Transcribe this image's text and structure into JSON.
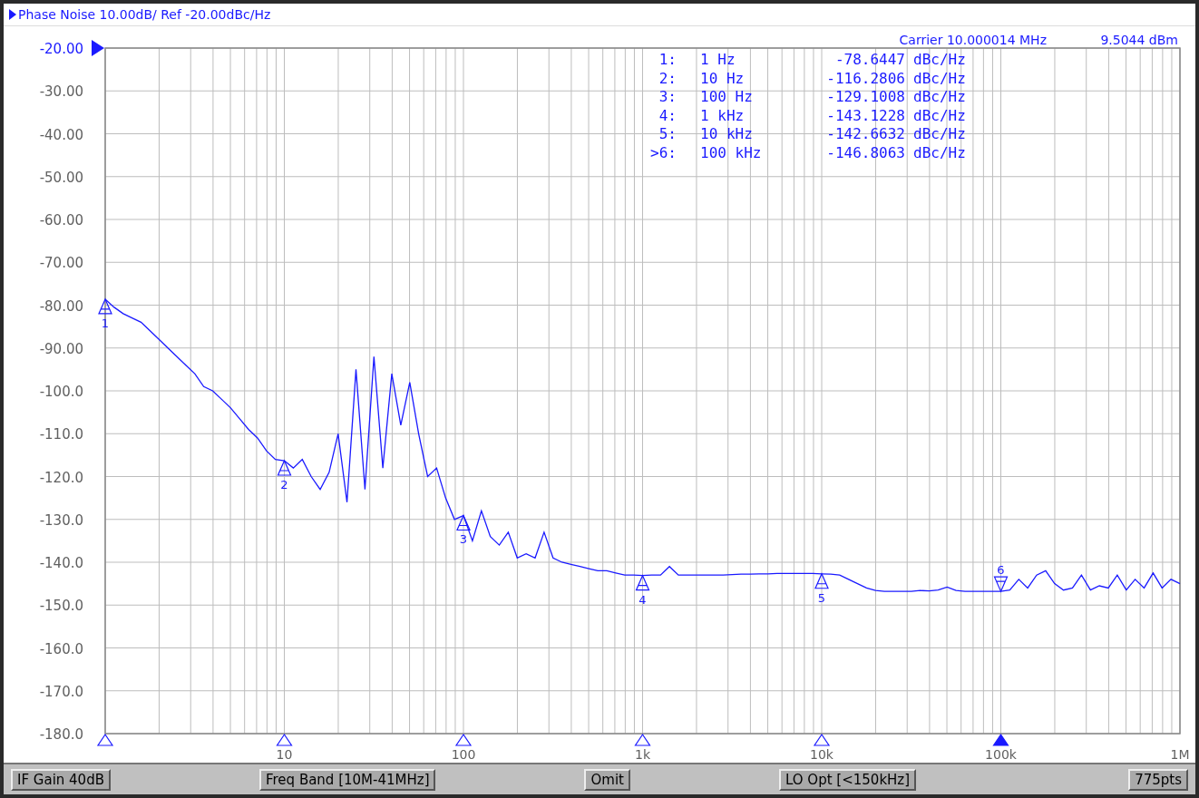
{
  "header": {
    "title": "Phase Noise 10.00dB/ Ref -20.00dBc/Hz"
  },
  "carrier": {
    "frequency": "Carrier 10.000014 MHz",
    "power": "9.5044 dBm"
  },
  "marker_table": [
    {
      "label": "1:",
      "frequency": "1 Hz",
      "value": "-78.6447",
      "unit": "dBc/Hz"
    },
    {
      "label": "2:",
      "frequency": "10 Hz",
      "value": "-116.2806",
      "unit": "dBc/Hz"
    },
    {
      "label": "3:",
      "frequency": "100 Hz",
      "value": "-129.1008",
      "unit": "dBc/Hz"
    },
    {
      "label": "4:",
      "frequency": "1 kHz",
      "value": "-143.1228",
      "unit": "dBc/Hz"
    },
    {
      "label": "5:",
      "frequency": "10 kHz",
      "value": "-142.6632",
      "unit": "dBc/Hz"
    },
    {
      "label": ">6:",
      "frequency": "100 kHz",
      "value": "-146.8063",
      "unit": "dBc/Hz"
    }
  ],
  "trace_markers": [
    {
      "number": "1",
      "selected": false
    },
    {
      "number": "2",
      "selected": false
    },
    {
      "number": "3",
      "selected": false
    },
    {
      "number": "4",
      "selected": false
    },
    {
      "number": "5",
      "selected": false
    },
    {
      "number": "6",
      "selected": true
    }
  ],
  "reference": {
    "label": "-20.00"
  },
  "chart_data": {
    "type": "line",
    "grid": true,
    "categories": [
      null,
      null,
      null,
      null,
      null,
      null,
      null,
      null,
      null,
      null,
      null,
      null,
      null,
      null,
      null,
      null,
      null,
      null,
      null,
      null,
      "10",
      null,
      null,
      null,
      null,
      null,
      null,
      null,
      null,
      null,
      null,
      null,
      null,
      null,
      null,
      null,
      null,
      null,
      null,
      null,
      "100",
      null,
      null,
      null,
      null,
      null,
      null,
      null,
      null,
      null,
      null,
      null,
      null,
      null,
      null,
      null,
      null,
      null,
      null,
      null,
      "1k",
      null,
      null,
      null,
      null,
      null,
      null,
      null,
      null,
      null,
      null,
      null,
      null,
      null,
      null,
      null,
      null,
      null,
      null,
      null,
      "10k",
      null,
      null,
      null,
      null,
      null,
      null,
      null,
      null,
      null,
      null,
      null,
      null,
      null,
      null,
      null,
      null,
      null,
      null,
      null,
      "100k",
      null,
      null,
      null,
      null,
      null,
      null,
      null,
      null,
      null,
      null,
      null,
      null,
      null,
      null,
      null,
      null,
      null,
      null,
      null,
      "1M"
    ],
    "series": [
      {
        "color": "#1a1aff",
        "values": [
          -78.6,
          -80.5,
          -82,
          -83,
          -84,
          -86,
          -88,
          -90,
          -92,
          -94,
          -96,
          -99,
          -100,
          -102,
          -104,
          -106.5,
          -109,
          -111,
          -114,
          -116,
          -116.3,
          -118,
          -116,
          -120,
          -123,
          -119,
          -110,
          -126,
          -95,
          -123,
          -92,
          -118,
          -96,
          -108,
          -98,
          -110,
          -120,
          -118,
          -125,
          -130,
          -129.1,
          -135,
          -128,
          -134,
          -136,
          -133,
          -139,
          -138,
          -139,
          -133,
          -139,
          -140,
          -140.5,
          -141,
          -141.5,
          -142,
          -142,
          -142.5,
          -143,
          -143,
          -143.1,
          -143,
          -143,
          -141,
          -143,
          -143,
          -143,
          -143,
          -143,
          -143,
          -142.9,
          -142.8,
          -142.8,
          -142.7,
          -142.7,
          -142.6,
          -142.6,
          -142.6,
          -142.6,
          -142.6,
          -142.7,
          -142.8,
          -143,
          -144,
          -145,
          -146,
          -146.6,
          -146.8,
          -146.8,
          -146.8,
          -146.8,
          -146.6,
          -146.7,
          -146.5,
          -145.8,
          -146.6,
          -146.8,
          -146.8,
          -146.8,
          -146.8,
          -146.8,
          -146.5,
          -144,
          -146,
          -143,
          -142,
          -145,
          -146.5,
          -146,
          -143,
          -146.5,
          -145.5,
          -146,
          -143,
          -146.5,
          -144,
          -146,
          -142.5,
          -146,
          -144,
          -145
        ]
      }
    ],
    "ylim": [
      -180,
      -20
    ],
    "yticks": [
      {
        "value": -30,
        "label": "-30.00"
      },
      {
        "value": -40,
        "label": "-40.00"
      },
      {
        "value": -50,
        "label": "-50.00"
      },
      {
        "value": -60,
        "label": "-60.00"
      },
      {
        "value": -70,
        "label": "-70.00"
      },
      {
        "value": -80,
        "label": "-80.00"
      },
      {
        "value": -90,
        "label": "-90.00"
      },
      {
        "value": -100,
        "label": "-100.0"
      },
      {
        "value": -110,
        "label": "-110.0"
      },
      {
        "value": -120,
        "label": "-120.0"
      },
      {
        "value": -130,
        "label": "-130.0"
      },
      {
        "value": -140,
        "label": "-140.0"
      },
      {
        "value": -150,
        "label": "-150.0"
      },
      {
        "value": -160,
        "label": "-160.0"
      },
      {
        "value": -170,
        "label": "-170.0"
      },
      {
        "value": -180,
        "label": "-180.0"
      }
    ]
  },
  "status_bar": [
    "IF Gain 40dB",
    "Freq Band [10M-41MHz]",
    "Omit",
    "LO Opt [<150kHz]",
    "775pts"
  ]
}
